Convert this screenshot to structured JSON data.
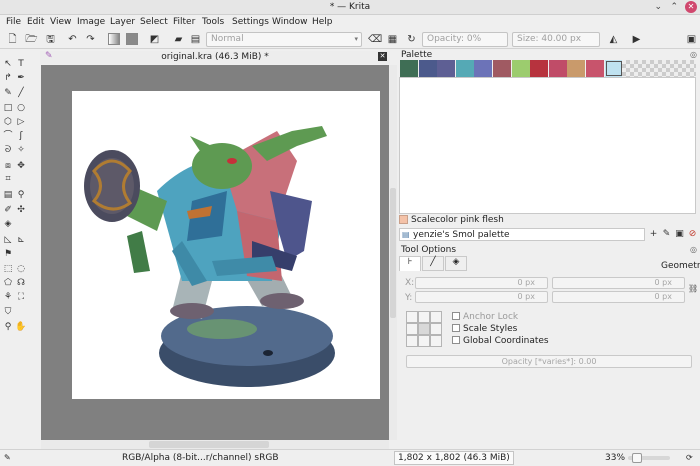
{
  "window": {
    "title": "* — Krita"
  },
  "menu": [
    "File",
    "Edit",
    "View",
    "Image",
    "Layer",
    "Select",
    "Filter",
    "Tools",
    "Settings",
    "Window",
    "Help"
  ],
  "toolbar": {
    "blend_mode": "Normal",
    "opacity": "Opacity:  0%",
    "size": "Size:  40.00 px"
  },
  "document": {
    "tab_title": "original.kra (46.3 MiB) *"
  },
  "palette_docker": {
    "title": "Palette",
    "swatch_colors": [
      "#3f6e55",
      "#4c5a8c",
      "#5e5f94",
      "#55a9b5",
      "#6c73b8",
      "#a05a62",
      "#9ccc6e",
      "#b7333e",
      "#c04c68",
      "#c99a6b",
      "#c8546c",
      "#bfe2f0",
      "#f1c39d"
    ],
    "selected_color_name": "Scalecolor pink flesh",
    "selected_color": "#f4c2a8",
    "palette_name": "yenzie's Smol palette"
  },
  "tool_options": {
    "title": "Tool Options",
    "mode": "Geometry",
    "x_label": "X:",
    "y_label": "Y:",
    "x_value": "0 px",
    "x2_value": "0 px",
    "y_value": "0 px",
    "y2_value": "0 px",
    "anchor_lock": "Anchor Lock",
    "scale_styles": "Scale Styles",
    "global_coordinates": "Global Coordinates",
    "opacity": "Opacity [*varies*]:  0.00"
  },
  "status": {
    "color_space": "RGB/Alpha (8-bit...r/channel)  sRGB",
    "dimensions": "1,802 x 1,802 (46.3 MiB)",
    "zoom": "33%"
  }
}
